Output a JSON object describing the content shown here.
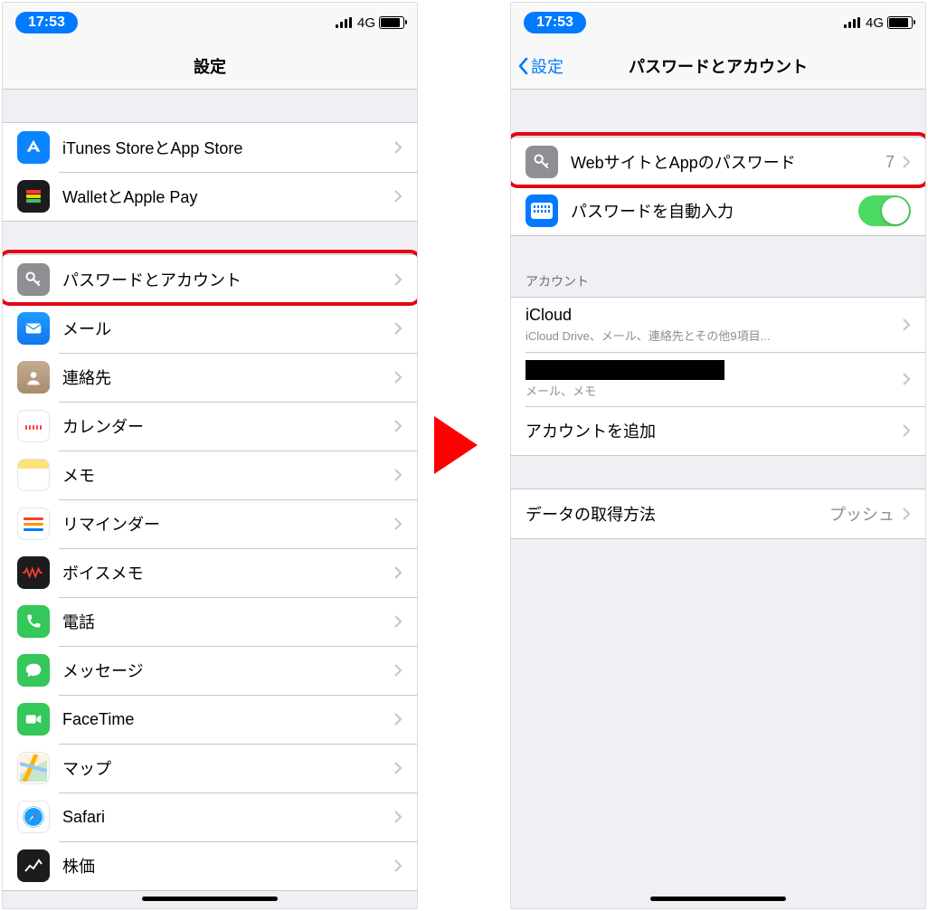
{
  "status": {
    "time": "17:53",
    "network": "4G"
  },
  "left": {
    "title": "設定",
    "group1": [
      {
        "label": "iTunes StoreとApp Store"
      },
      {
        "label": "WalletとApple Pay"
      }
    ],
    "group2": [
      {
        "label": "パスワードとアカウント"
      },
      {
        "label": "メール"
      },
      {
        "label": "連絡先"
      },
      {
        "label": "カレンダー"
      },
      {
        "label": "メモ"
      },
      {
        "label": "リマインダー"
      },
      {
        "label": "ボイスメモ"
      },
      {
        "label": "電話"
      },
      {
        "label": "メッセージ"
      },
      {
        "label": "FaceTime"
      },
      {
        "label": "マップ"
      },
      {
        "label": "Safari"
      },
      {
        "label": "株価"
      }
    ]
  },
  "right": {
    "back": "設定",
    "title": "パスワードとアカウント",
    "group1": {
      "passwords": {
        "label": "WebサイトとAppのパスワード",
        "count": "7"
      },
      "autofill": {
        "label": "パスワードを自動入力"
      }
    },
    "accounts_header": "アカウント",
    "accounts": {
      "icloud": {
        "title": "iCloud",
        "sub": "iCloud Drive、メール、連絡先とその他9項目..."
      },
      "redacted_sub": "メール、メモ",
      "add": "アカウントを追加"
    },
    "fetch": {
      "label": "データの取得方法",
      "value": "プッシュ"
    }
  }
}
